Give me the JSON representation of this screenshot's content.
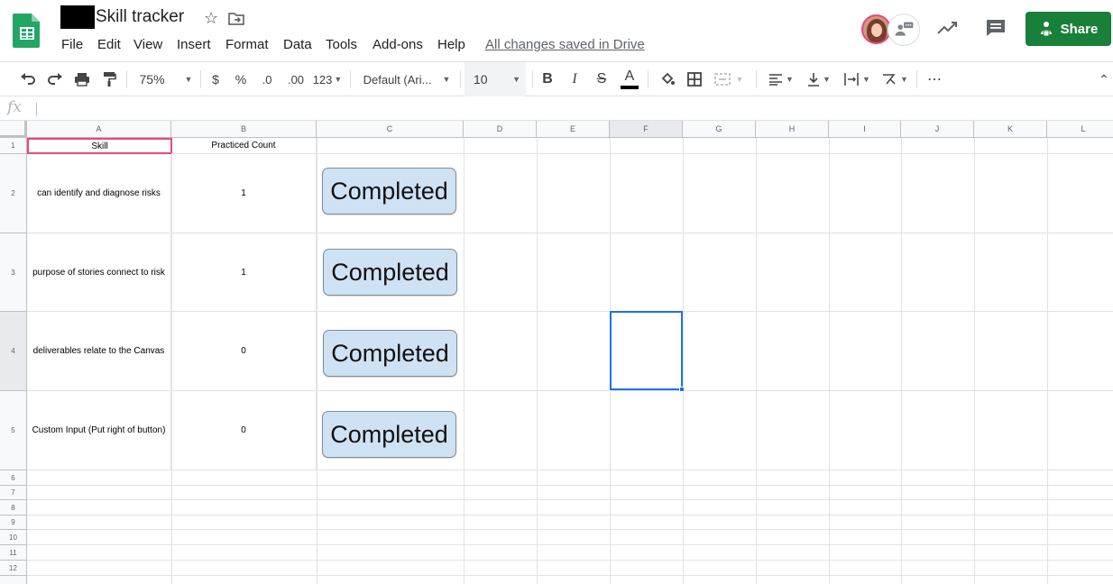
{
  "document": {
    "title": "Skill tracker",
    "saved_status": "All changes saved in Drive"
  },
  "menu": [
    "File",
    "Edit",
    "View",
    "Insert",
    "Format",
    "Data",
    "Tools",
    "Add-ons",
    "Help"
  ],
  "share_label": "Share",
  "toolbar": {
    "zoom": "75%",
    "currency": "$",
    "percent": "%",
    "decrease_decimal": ".0",
    "increase_decimal": ".00",
    "more_formats": "123",
    "font": "Default (Ari...",
    "font_size": "10",
    "bold": "B",
    "italic": "I",
    "strikethrough": "S",
    "text_color": "A",
    "more": "⋯"
  },
  "formula_bar": {
    "label": "fx",
    "content": ""
  },
  "columns": [
    "A",
    "B",
    "C",
    "D",
    "E",
    "F",
    "G",
    "H",
    "I",
    "J",
    "K",
    "L"
  ],
  "rows": [
    "1",
    "2",
    "3",
    "4",
    "5",
    "6",
    "7",
    "8",
    "9",
    "10",
    "11",
    "12"
  ],
  "headers": {
    "skill": "Skill",
    "count": "Practiced Count"
  },
  "skills": [
    {
      "skill": "can identify and diagnose risks",
      "count": "1",
      "button": "Completed"
    },
    {
      "skill": "purpose of stories connect to risk",
      "count": "1",
      "button": "Completed"
    },
    {
      "skill": "deliverables relate to the Canvas",
      "count": "0",
      "button": "Completed"
    },
    {
      "skill": "Custom Input (Put right of button)",
      "count": "0",
      "button": "Completed"
    }
  ],
  "colors": {
    "share": "#188038",
    "selection": "#1a73e8",
    "active_cell": "#e8467c",
    "button_fill": "#cfe2f3"
  }
}
